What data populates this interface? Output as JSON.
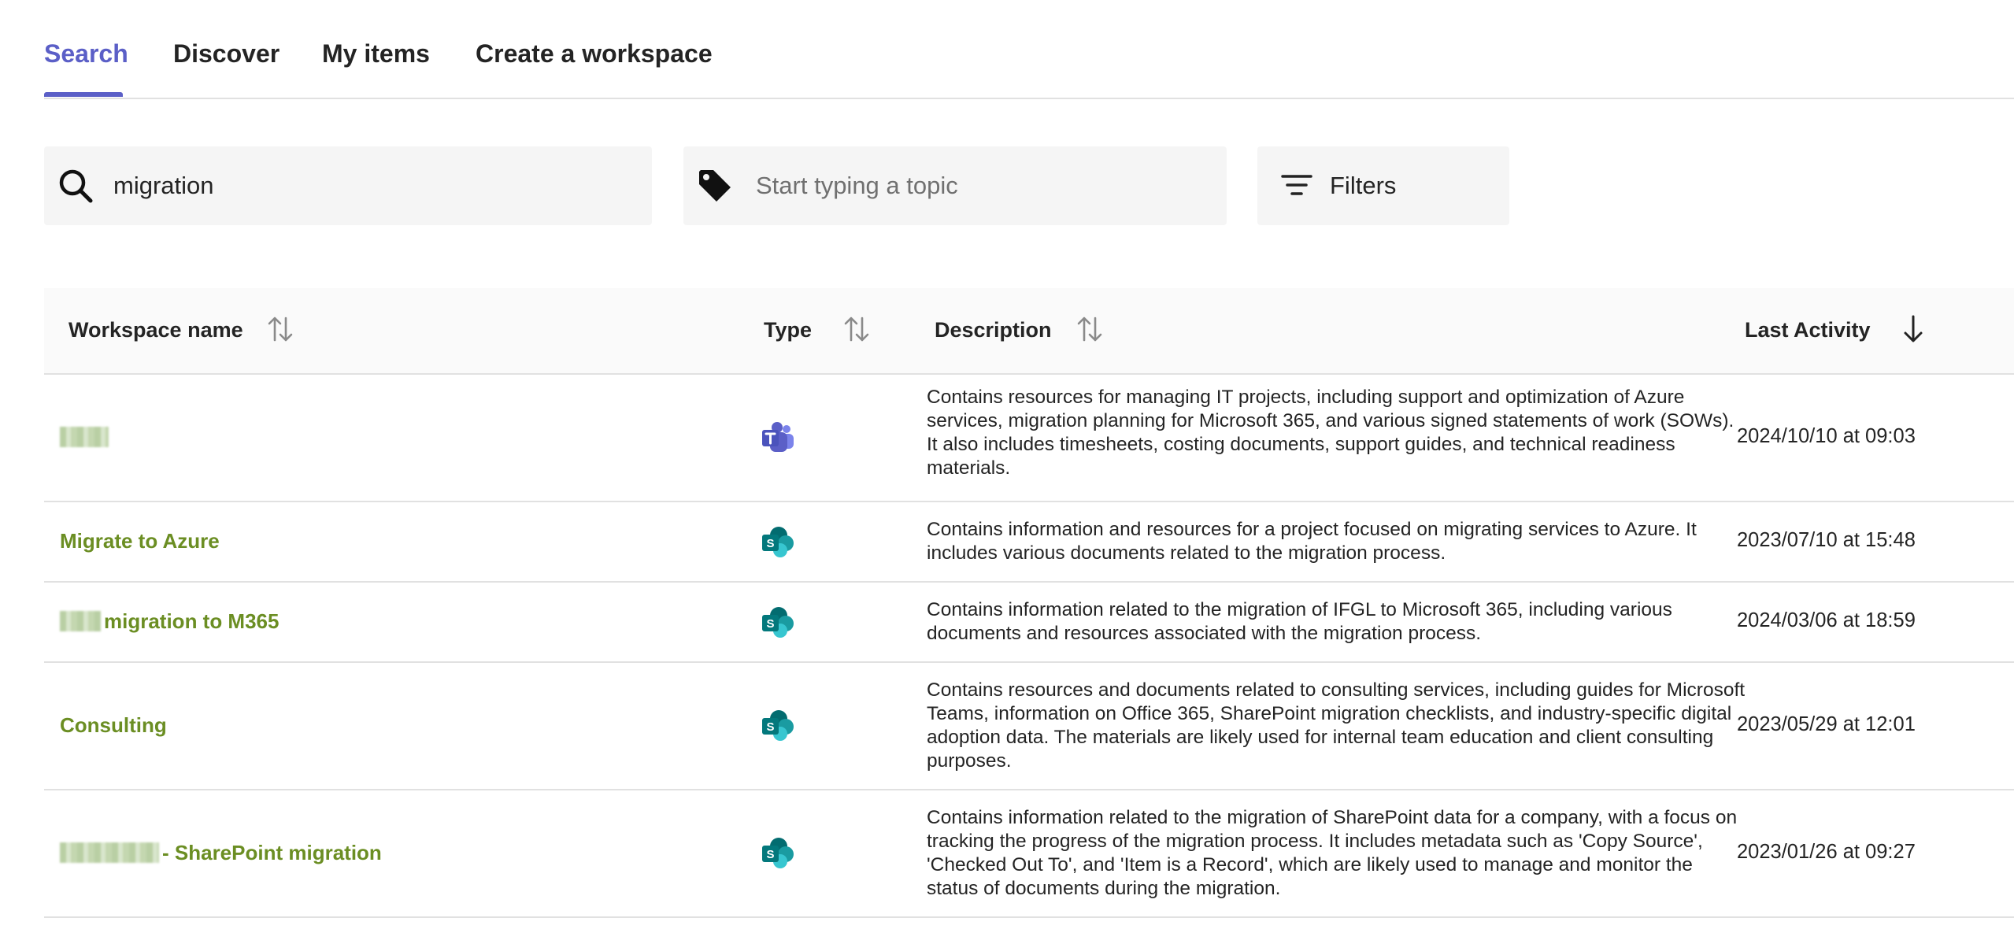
{
  "tabs": [
    {
      "label": "Search",
      "active": true
    },
    {
      "label": "Discover",
      "active": false
    },
    {
      "label": "My items",
      "active": false
    },
    {
      "label": "Create a workspace",
      "active": false
    }
  ],
  "search": {
    "value": "migration",
    "icon": "search-icon"
  },
  "topic": {
    "placeholder": "Start typing a topic",
    "icon": "tag-icon"
  },
  "filters": {
    "label": "Filters",
    "icon": "filter-icon"
  },
  "table": {
    "columns": [
      {
        "label": "Workspace name",
        "sort_icon": "sort-both-icon"
      },
      {
        "label": "Type",
        "sort_icon": "sort-both-icon"
      },
      {
        "label": "Description",
        "sort_icon": "sort-both-icon"
      },
      {
        "label": "Last Activity",
        "sort_icon": "sort-descending-icon"
      }
    ],
    "rows": [
      {
        "name": "",
        "name_redacted": true,
        "type": "teams-icon",
        "description": "Contains resources for managing IT projects, including support and optimization of Azure services, migration planning for Microsoft 365, and various signed statements of work (SOWs). It also includes timesheets, costing documents, support guides, and technical readiness materials.",
        "last_activity": "2024/10/10 at 09:03"
      },
      {
        "name": "Migrate to Azure",
        "type": "sharepoint-icon",
        "description": "Contains information and resources for a project focused on migrating services to Azure. It includes various documents related to the migration process.",
        "last_activity": "2023/07/10 at 15:48"
      },
      {
        "name": "migration to M365",
        "name_redacted_prefix": true,
        "type": "sharepoint-icon",
        "description": "Contains information related to the migration of IFGL to Microsoft 365, including various documents and resources associated with the migration process.",
        "last_activity": "2024/03/06 at 18:59"
      },
      {
        "name": "Consulting",
        "type": "sharepoint-icon",
        "description": "Contains resources and documents related to consulting services, including guides for Microsoft Teams, information on Office 365, SharePoint migration checklists, and industry-specific digital adoption data. The materials are likely used for internal team education and client consulting purposes.",
        "last_activity": "2023/05/29 at 12:01"
      },
      {
        "name": "- SharePoint migration",
        "name_redacted_prefix": true,
        "type": "sharepoint-icon",
        "description": "Contains information related to the migration of SharePoint data for a company, with a focus on tracking the progress of the migration process. It includes metadata such as 'Copy Source', 'Checked Out To', and 'Item is a Record', which are likely used to manage and monitor the status of documents during the migration.",
        "last_activity": "2023/01/26 at 09:27"
      }
    ]
  },
  "colors": {
    "accent": "#5b5fc7",
    "link_green": "#6b8e23",
    "field_bg": "#f5f5f5",
    "header_bg": "#fafafa",
    "divider": "#e1e1e1"
  }
}
